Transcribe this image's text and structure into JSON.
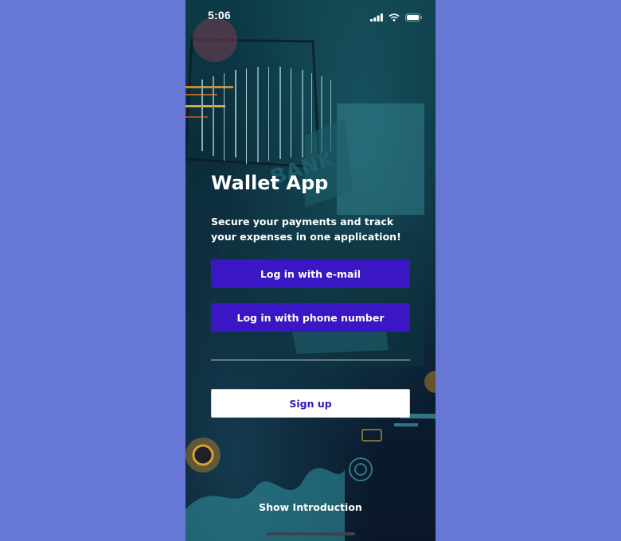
{
  "status_bar": {
    "time": "5:06",
    "icons": [
      "signal-icon",
      "wifi-icon",
      "battery-icon"
    ]
  },
  "background": {
    "art_text": "BANK"
  },
  "main": {
    "title": "Wallet App",
    "subtitle": "Secure your payments and track your expenses in one application!",
    "email_login_label": "Log in with e-mail",
    "phone_login_label": "Log in with phone number",
    "signup_label": "Sign up",
    "intro_link_label": "Show Introduction"
  },
  "colors": {
    "page_background": "#6677d6",
    "primary_button": "#3a16c4",
    "signup_text": "#3a16c4",
    "text": "#ffffff"
  }
}
